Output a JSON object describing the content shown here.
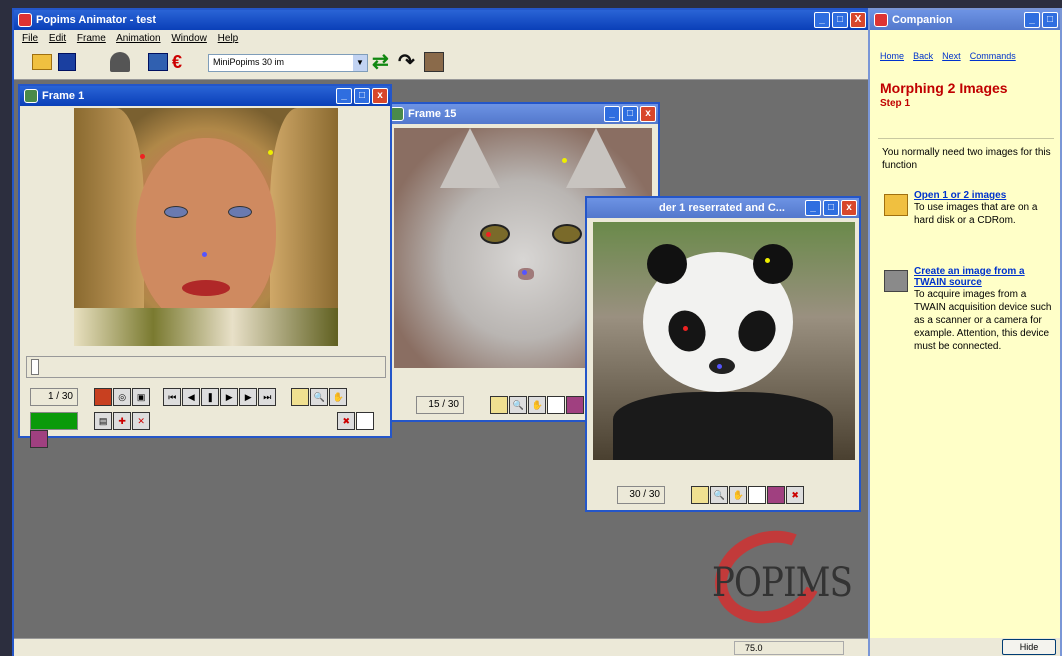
{
  "main_window": {
    "title": "Popims Animator - test",
    "close_x": "X"
  },
  "menu": [
    "File",
    "Edit",
    "Frame",
    "Animation",
    "Window",
    "Help"
  ],
  "toolbar": {
    "preset_select": "MiniPopims 30 im"
  },
  "frame1": {
    "title": "Frame 1",
    "counter": "1 / 30",
    "status_counter": "30 / 30"
  },
  "frame15": {
    "title": "Frame 15",
    "counter": "15 / 30"
  },
  "frame30": {
    "title": "der 1 reserrated and C...",
    "counter": "30 / 30"
  },
  "logo": "POPIMS",
  "statusbar": {
    "zoom": "75.0"
  },
  "companion": {
    "title": "Companion",
    "links": [
      "Home",
      "Back",
      "Next",
      "Commands"
    ],
    "heading": "Morphing 2 Images",
    "step": "Step 1",
    "intro": "You normally need two images for this function",
    "options": [
      {
        "link": "Open 1 or 2 images",
        "desc": "To use images that are on a hard disk or a CDRom."
      },
      {
        "link": "Create an image from a TWAIN source",
        "desc": "To acquire images from a TWAIN acquisition device such as a scanner or a camera for example. Attention, this device must be connected."
      }
    ],
    "hide_button": "Hide"
  },
  "colors": {
    "titlebar": "#0a3fb8",
    "workspace": "#6e6e6e",
    "companion_bg": "#ffffc8",
    "heading": "#c00000"
  }
}
